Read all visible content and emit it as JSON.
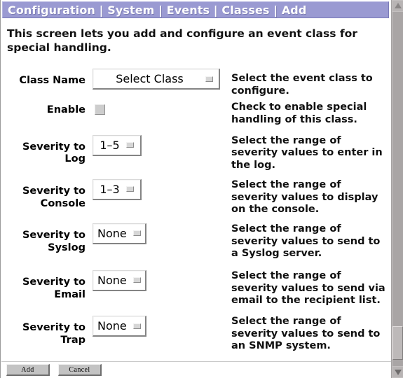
{
  "window": {
    "title": "Configuration | System | Events | Classes | Add"
  },
  "intro": {
    "text": "This screen lets you add and configure an event class for special handling."
  },
  "form": {
    "rows": [
      {
        "label": "Class Name",
        "control": "dropdown",
        "value": "Select Class",
        "help": "Select the event class to configure."
      },
      {
        "label": "Enable",
        "control": "checkbox",
        "value": "",
        "help": "Check to enable special handling of this class."
      },
      {
        "label": "Severity to Log",
        "control": "dropdown",
        "value": "1–5",
        "help": "Select the range of severity values to enter in the log."
      },
      {
        "label": "Severity to Console",
        "control": "dropdown",
        "value": "1–3",
        "help": "Select the range of severity values to display on the console."
      },
      {
        "label": "Severity to Syslog",
        "control": "dropdown",
        "value": "None",
        "help": "Select the range of severity values to send to a Syslog server."
      },
      {
        "label": "Severity to Email",
        "control": "dropdown",
        "value": "None",
        "help": "Select the range of severity values to send via email to the recipient list."
      },
      {
        "label": "Severity to Trap",
        "control": "dropdown",
        "value": "None",
        "help": "Select the range of severity values to send to an SNMP system."
      }
    ]
  },
  "buttons": {
    "add_label": "Add",
    "cancel_label": "Cancel"
  },
  "scrollbar": {
    "up_icon": "triangle-up-icon",
    "down_icon": "triangle-down-icon"
  },
  "colors": {
    "titlebar_bg": "#9a9ad2",
    "titlebar_text": "#ffffff",
    "page_bg": "#ffffff",
    "scrollbar_bg": "#c4c0c0",
    "button_face": "#c3c3c3"
  }
}
